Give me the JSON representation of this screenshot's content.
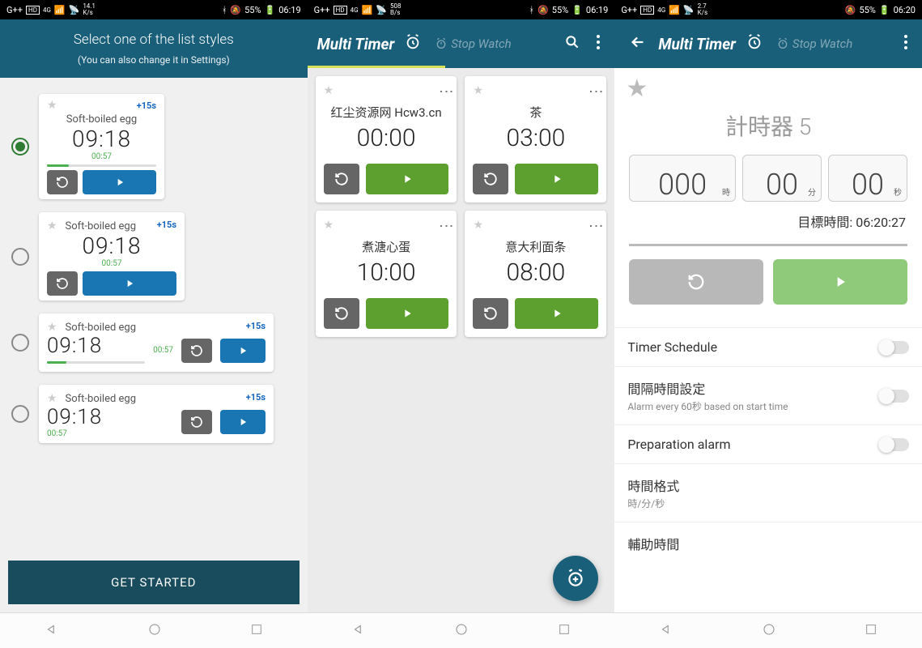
{
  "screen1": {
    "status": {
      "carrier": "G++",
      "hd": "HD",
      "sig4g": "4G",
      "speed": "14.1",
      "speedUnit": "K/s",
      "battery": "55%",
      "time": "06:19"
    },
    "header": {
      "title": "Select one of the list styles",
      "subtitle": "(You can also change it in Settings)"
    },
    "example": {
      "name": "Soft-boiled egg",
      "time": "09:18",
      "elapsed": "00:57",
      "plus": "+15s"
    },
    "cta": "GET STARTED"
  },
  "screen2": {
    "status": {
      "carrier": "G++",
      "hd": "HD",
      "sig4g": "4G",
      "speed": "508",
      "speedUnit": "B/s",
      "battery": "55%",
      "time": "06:19"
    },
    "brand": "Multi Timer",
    "tab2": "Stop Watch",
    "timers": [
      {
        "name": "红尘资源网 Hcw3.cn",
        "time": "00:00"
      },
      {
        "name": "茶",
        "time": "03:00"
      },
      {
        "name": "煮溏心蛋",
        "time": "10:00"
      },
      {
        "name": "意大利面条",
        "time": "08:00"
      }
    ]
  },
  "screen3": {
    "status": {
      "carrier": "G++",
      "hd": "HD",
      "sig4g": "4G",
      "speed": "2.7",
      "speedUnit": "K/s",
      "battery": "55%",
      "time": "06:20"
    },
    "brand": "Multi Timer",
    "tab2": "Stop Watch",
    "timerName": "計時器 5",
    "h": "000",
    "m": "00",
    "s": "00",
    "hU": "時",
    "mU": "分",
    "sU": "秒",
    "target": "目標時間: 06:20:27",
    "settings": {
      "schedule": "Timer Schedule",
      "interval": "間隔時間設定",
      "intervalSub": "Alarm every 60秒 based on start time",
      "prep": "Preparation alarm",
      "format": "時間格式",
      "formatSub": "時/分/秒",
      "aux": "輔助時間"
    }
  }
}
